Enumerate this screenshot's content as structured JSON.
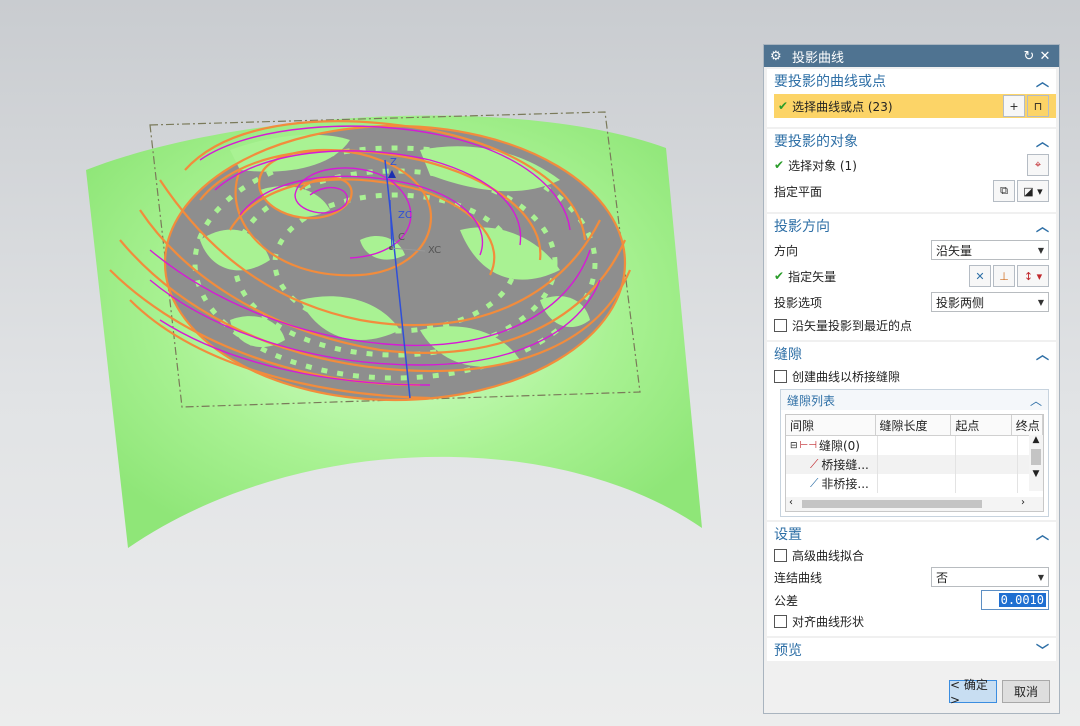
{
  "dialog": {
    "title": "投影曲线",
    "reset_icon": "reset-icon",
    "close_icon": "close-icon"
  },
  "section_curves": {
    "header": "要投影的曲线或点",
    "select_label": "选择曲线或点 (23)"
  },
  "section_target": {
    "header": "要投影的对象",
    "select_label": "选择对象 (1)",
    "plane_label": "指定平面"
  },
  "section_direction": {
    "header": "投影方向",
    "direction_label": "方向",
    "direction_value": "沿矢量",
    "vector_label": "指定矢量",
    "option_label": "投影选项",
    "option_value": "投影两侧",
    "nearest_label": "沿矢量投影到最近的点"
  },
  "section_gap": {
    "header": "缝隙",
    "create_label": "创建曲线以桥接缝隙",
    "list_header": "缝隙列表",
    "columns": [
      "间隙",
      "缝隙长度",
      "起点",
      "终点"
    ],
    "rows": [
      "缝隙(0)",
      "桥接缝...",
      "非桥接..."
    ]
  },
  "section_settings": {
    "header": "设置",
    "advanced_fit_label": "高级曲线拟合",
    "join_label": "连结曲线",
    "join_value": "否",
    "tolerance_label": "公差",
    "tolerance_value": "0.0010",
    "align_label": "对齐曲线形状"
  },
  "section_preview": {
    "header": "预览"
  },
  "buttons": {
    "ok": "< 确定 >",
    "cancel": "取消"
  },
  "viewport": {
    "axis_z": "Z",
    "axis_zc": "ZC",
    "axis_xc": "XC",
    "axis_c": "C"
  },
  "colors": {
    "surface": "#9cee84",
    "curve_orange": "#f28c3c",
    "curve_magenta": "#d61ad6",
    "hole_gray": "#8e8e8e",
    "titlebar": "#4f7391",
    "highlight": "#fcd467"
  }
}
